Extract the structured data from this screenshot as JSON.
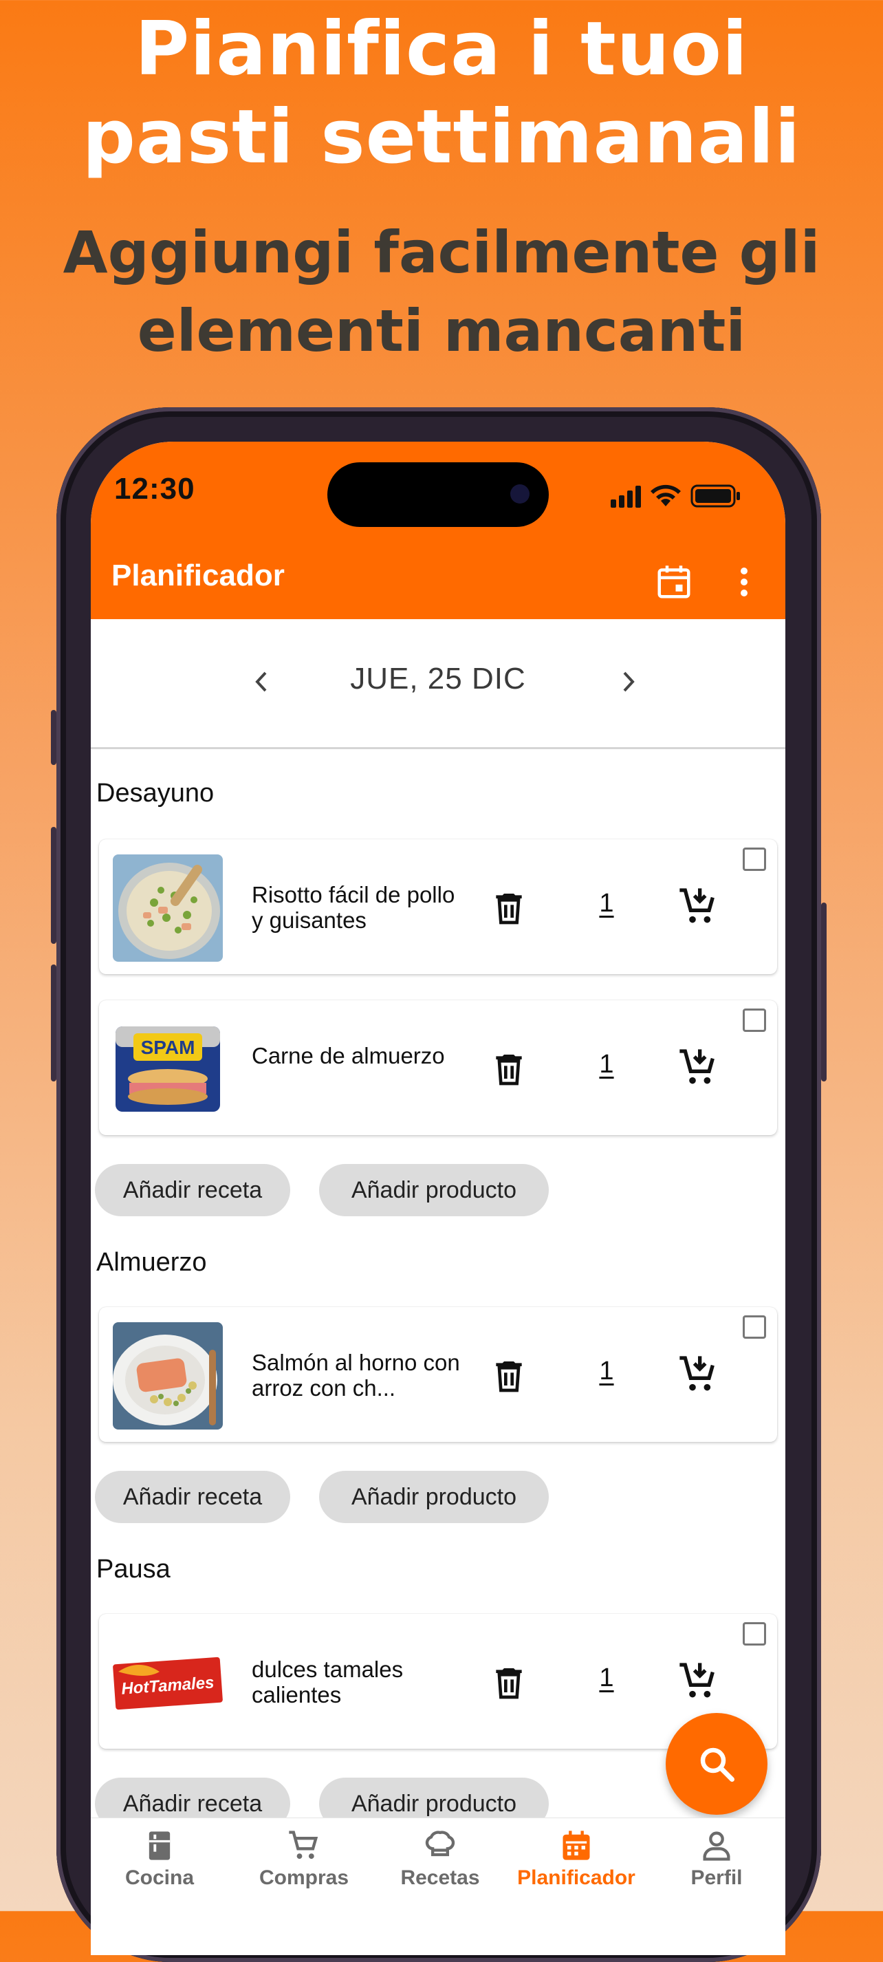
{
  "promo": {
    "headline_line1": "Pianifica i tuoi",
    "headline_line2": "pasti settimanali",
    "subline_line1": "Aggiungi facilmente gli",
    "subline_line2": "elementi mancanti"
  },
  "status_bar": {
    "time": "12:30"
  },
  "app_bar": {
    "title": "Planificador",
    "icons": [
      "calendar-icon",
      "more-vert-icon"
    ]
  },
  "date_nav": {
    "date": "JUE, 25 DIC"
  },
  "meals": [
    {
      "title": "Desayuno",
      "items": [
        {
          "name": "Risotto fácil de pollo y guisantes",
          "qty": "1"
        },
        {
          "name": "Carne de almuerzo",
          "qty": "1"
        }
      ],
      "add_recipe": "Añadir receta",
      "add_product": "Añadir producto"
    },
    {
      "title": "Almuerzo",
      "items": [
        {
          "name": "Salmón al horno con arroz con ch...",
          "qty": "1"
        }
      ],
      "add_recipe": "Añadir receta",
      "add_product": "Añadir producto"
    },
    {
      "title": "Pausa",
      "items": [
        {
          "name": "dulces tamales calientes",
          "qty": "1"
        }
      ],
      "add_recipe": "Añadir receta",
      "add_product": "Añadir producto"
    }
  ],
  "bottom_nav": [
    {
      "label": "Cocina",
      "icon": "kitchen-icon",
      "active": false
    },
    {
      "label": "Compras",
      "icon": "cart-icon",
      "active": false
    },
    {
      "label": "Recetas",
      "icon": "chef-hat-icon",
      "active": false
    },
    {
      "label": "Planificador",
      "icon": "calendar-icon",
      "active": true
    },
    {
      "label": "Perfil",
      "icon": "person-icon",
      "active": false
    }
  ],
  "colors": {
    "brand": "#FF6A00",
    "chip_bg": "#DCDCDC",
    "inactive_nav": "#6B6B6B"
  }
}
